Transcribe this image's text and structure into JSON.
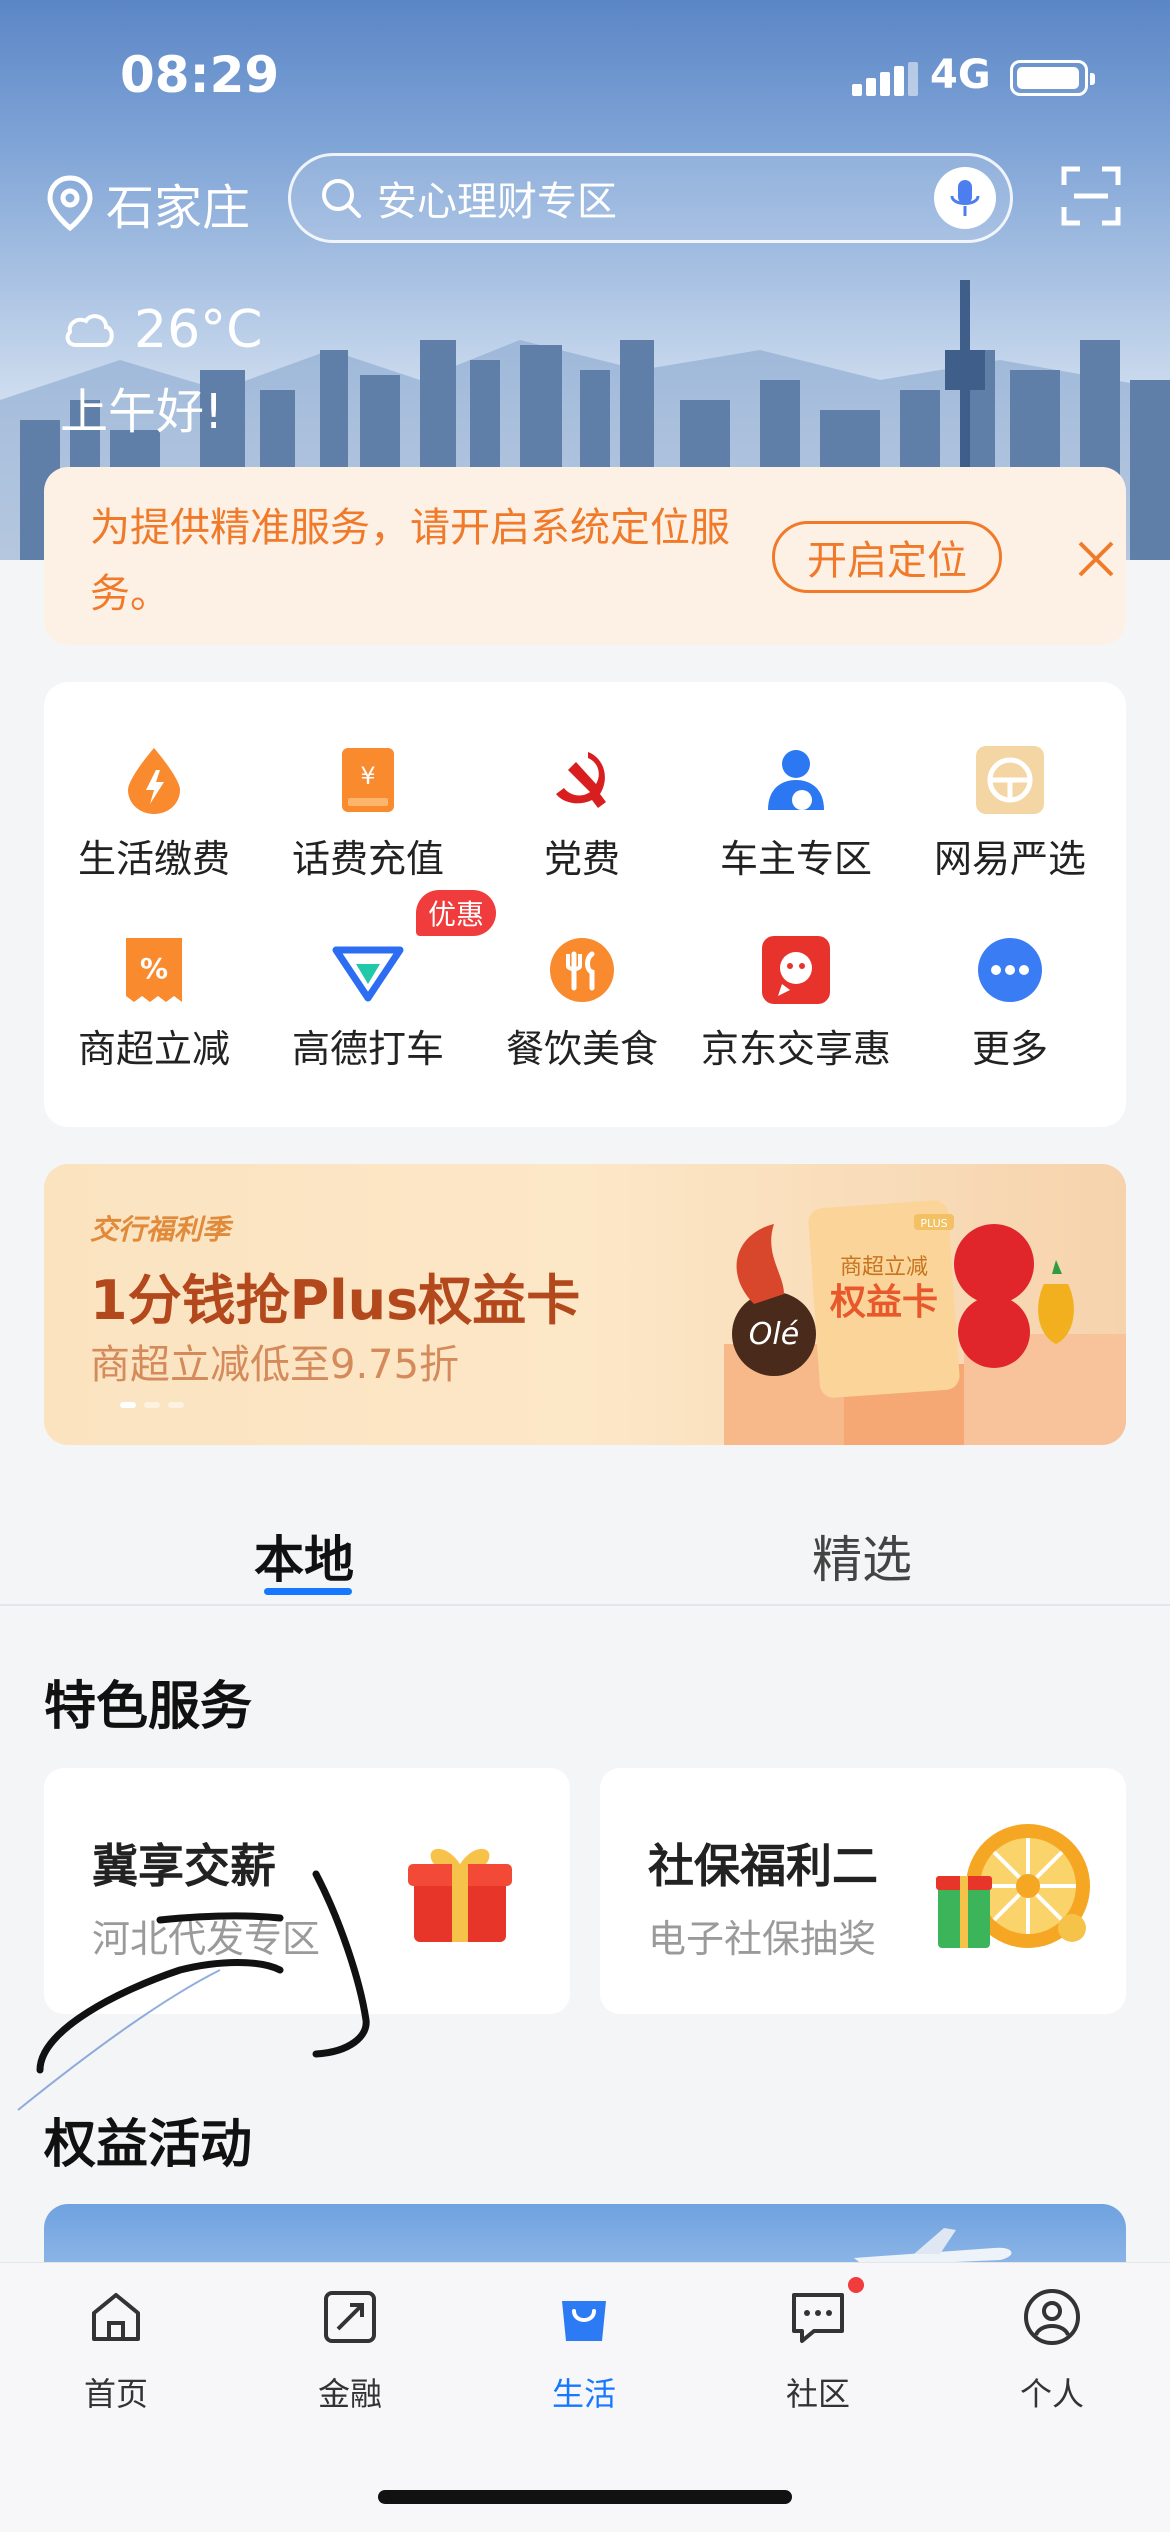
{
  "status_bar": {
    "time": "08:29",
    "network": "4G"
  },
  "header": {
    "city": "石家庄",
    "search_placeholder": "安心理财专区",
    "temperature": "26°C",
    "greeting": "上午好!"
  },
  "location_banner": {
    "message": "为提供精准服务，请开启系统定位服务。",
    "button_label": "开启定位"
  },
  "services": {
    "items": [
      {
        "label": "生活缴费",
        "icon": "utility-bill-icon"
      },
      {
        "label": "话费充值",
        "icon": "phone-recharge-icon"
      },
      {
        "label": "党费",
        "icon": "party-fee-icon"
      },
      {
        "label": "车主专区",
        "icon": "car-owner-icon"
      },
      {
        "label": "网易严选",
        "icon": "netease-yanxuan-icon"
      },
      {
        "label": "商超立减",
        "icon": "supermarket-discount-icon"
      },
      {
        "label": "高德打车",
        "icon": "amap-taxi-icon"
      },
      {
        "label": "餐饮美食",
        "icon": "dining-icon"
      },
      {
        "label": "京东交享惠",
        "icon": "jd-icon"
      },
      {
        "label": "更多",
        "icon": "more-icon"
      }
    ],
    "badge": "优惠"
  },
  "promo": {
    "brand": "交行福利季",
    "title": "1分钱抢Plus权益卡",
    "subtitle": "商超立减低至9.75折",
    "card_small": "商超立减",
    "card_big": "权益卡",
    "card_tag": "PLUS"
  },
  "tabs": {
    "local": "本地",
    "featured": "精选"
  },
  "features": {
    "title": "特色服务",
    "cards": [
      {
        "title": "冀享交薪",
        "subtitle": "河北代发专区"
      },
      {
        "title": "社保福利二",
        "subtitle": "电子社保抽奖"
      }
    ]
  },
  "activities": {
    "title": "权益活动"
  },
  "bottom_nav": {
    "items": [
      {
        "label": "首页",
        "icon": "home-icon"
      },
      {
        "label": "金融",
        "icon": "finance-icon"
      },
      {
        "label": "生活",
        "icon": "life-icon"
      },
      {
        "label": "社区",
        "icon": "community-icon"
      },
      {
        "label": "个人",
        "icon": "profile-icon"
      }
    ],
    "active": "生活"
  },
  "colors": {
    "accent": "#1677ff",
    "warning": "#f07a2a",
    "badge": "#f03c3c"
  }
}
